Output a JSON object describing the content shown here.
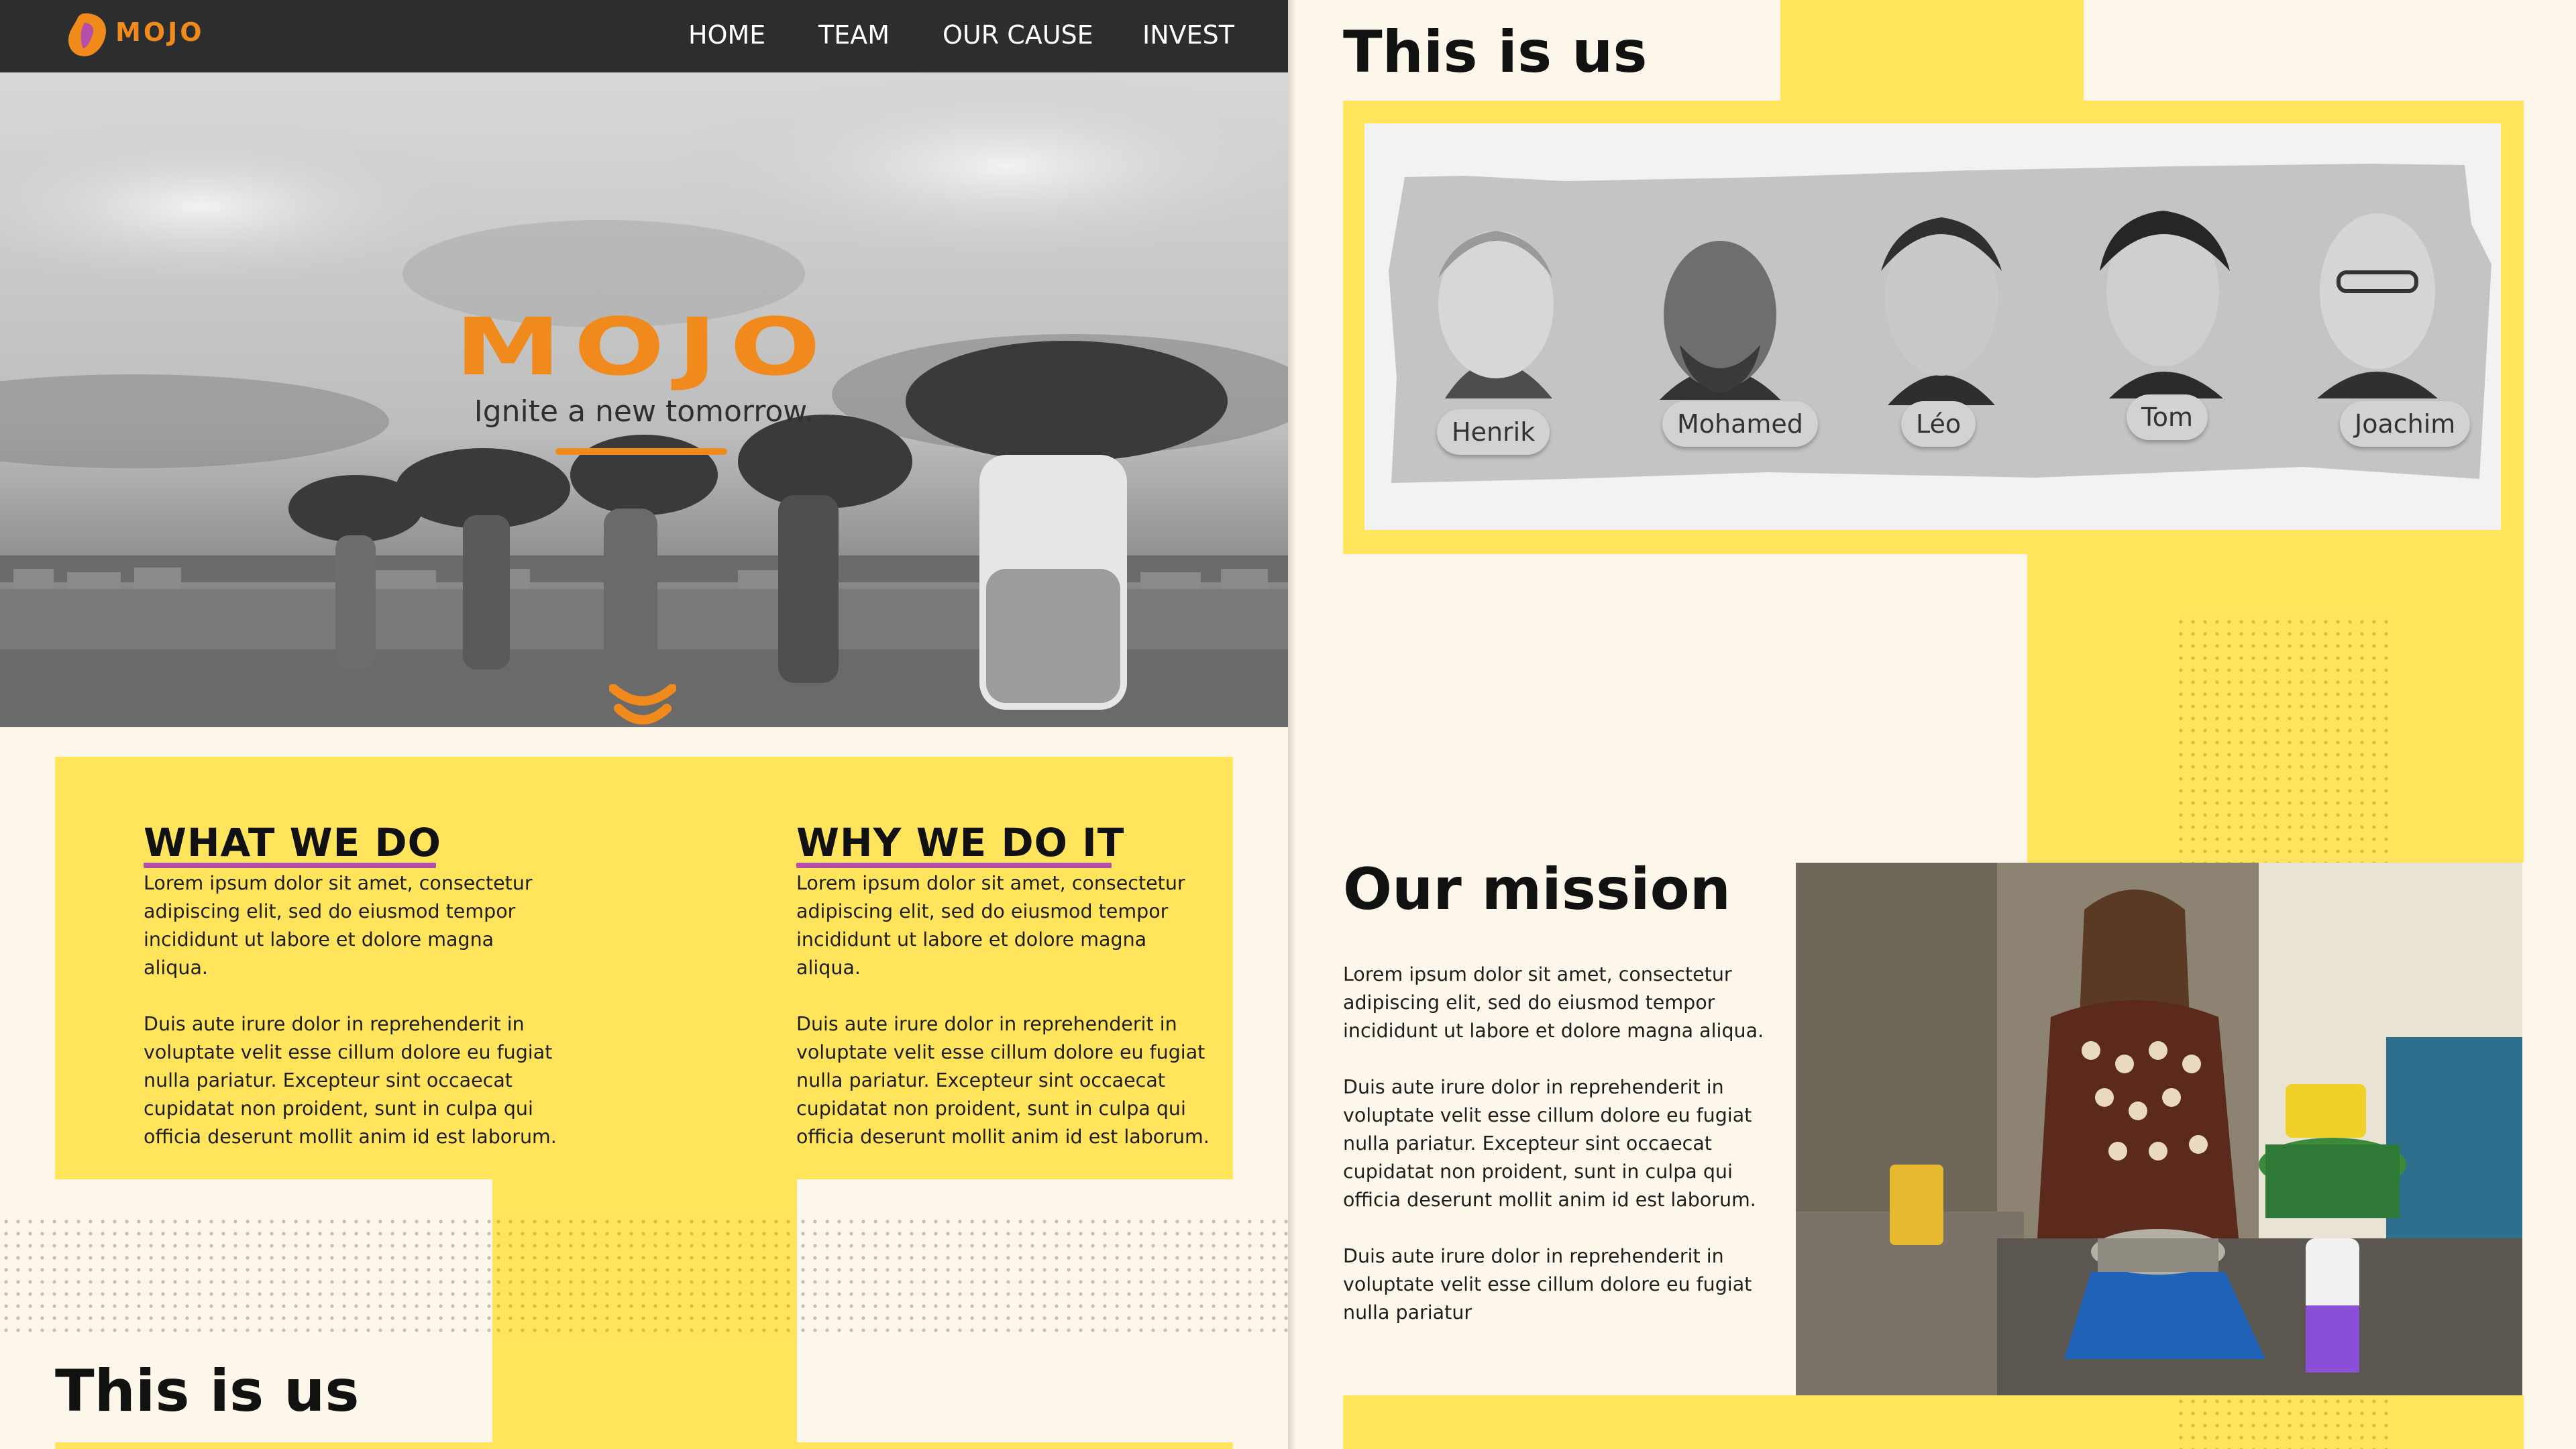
{
  "brand": {
    "name": "MOJO",
    "orange": "#f08a1c",
    "yellow": "#ffe45c",
    "dark": "#2b2d2f",
    "purple": "#b44ea8",
    "cream": "#fdf6ea"
  },
  "nav": {
    "logo_icon": "mojo-flame-icon",
    "items": [
      {
        "label": "HOME"
      },
      {
        "label": "TEAM"
      },
      {
        "label": "OUR CAUSE"
      },
      {
        "label": "INVEST"
      }
    ]
  },
  "hero": {
    "title": "MOJO",
    "subtitle": "Ignite a new tomorrow.",
    "scroll_icon": "chevron-down-icon"
  },
  "what_we_do": {
    "heading": "WHAT WE DO",
    "body": "Lorem ipsum dolor sit amet, consectetur\nadipiscing elit, sed do eiusmod tempor\nincididunt ut labore et dolore magna aliqua.\n\nDuis aute irure dolor in reprehenderit in\nvoluptate velit esse cillum dolore eu fugiat\nnulla pariatur. Excepteur sint occaecat\ncupidatat non proident, sunt in culpa qui\nofficia deserunt mollit anim id est laborum."
  },
  "why_we_do_it": {
    "heading": "WHY WE DO IT",
    "body": "Lorem ipsum dolor sit amet, consectetur\nadipiscing elit, sed do eiusmod tempor\nincididunt ut labore et dolore magna aliqua.\n\nDuis aute irure dolor in reprehenderit in\nvoluptate velit esse cillum dolore eu fugiat\nnulla pariatur. Excepteur sint occaecat\ncupidatat non proident, sunt in culpa qui\nofficia deserunt mollit anim id est laborum."
  },
  "left_footer": {
    "heading": "This is us"
  },
  "team": {
    "heading": "This is us",
    "members": [
      {
        "name": "Henrik"
      },
      {
        "name": "Mohamed"
      },
      {
        "name": "Léo"
      },
      {
        "name": "Tom"
      },
      {
        "name": "Joachim"
      }
    ]
  },
  "mission": {
    "heading": "Our mission",
    "body": "Lorem ipsum dolor sit amet, consectetur\nadipiscing elit, sed do eiusmod tempor\nincididunt ut labore et dolore magna aliqua.\n\nDuis aute irure dolor in reprehenderit in\nvoluptate velit esse cillum dolore eu fugiat\nnulla pariatur. Excepteur sint occaecat\ncupidatat non proident, sunt in culpa qui\nofficia deserunt mollit anim id est laborum.\n\nDuis aute irure dolor in reprehenderit in\nvoluptate velit esse cillum dolore eu fugiat\nnulla pariatur"
  }
}
